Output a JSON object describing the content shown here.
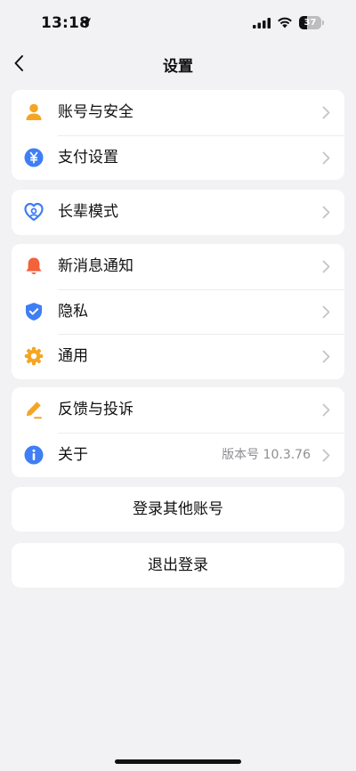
{
  "status_bar": {
    "time": "13:18",
    "battery_level": "37",
    "battery_fraction": 0.37
  },
  "nav": {
    "title": "设置"
  },
  "groups": [
    {
      "items": [
        {
          "label": "账号与安全",
          "icon": "person-icon",
          "icon_color": "#f4a623"
        },
        {
          "label": "支付设置",
          "icon": "yuan-icon",
          "icon_color": "#3f7ef4"
        }
      ]
    },
    {
      "items": [
        {
          "label": "长辈模式",
          "icon": "heart-person-icon",
          "icon_color": "#3f7ef4"
        }
      ]
    },
    {
      "items": [
        {
          "label": "新消息通知",
          "icon": "bell-icon",
          "icon_color": "#f2623b"
        },
        {
          "label": "隐私",
          "icon": "shield-icon",
          "icon_color": "#3f7ef4"
        },
        {
          "label": "通用",
          "icon": "gear-icon",
          "icon_color": "#f4a623"
        }
      ]
    },
    {
      "items": [
        {
          "label": "反馈与投诉",
          "icon": "pen-icon",
          "icon_color": "#f4a623"
        },
        {
          "label": "关于",
          "icon": "info-icon",
          "icon_color": "#3f7ef4",
          "value": "版本号 10.3.76"
        }
      ]
    }
  ],
  "buttons": {
    "switch_account": "登录其他账号",
    "logout": "退出登录"
  }
}
